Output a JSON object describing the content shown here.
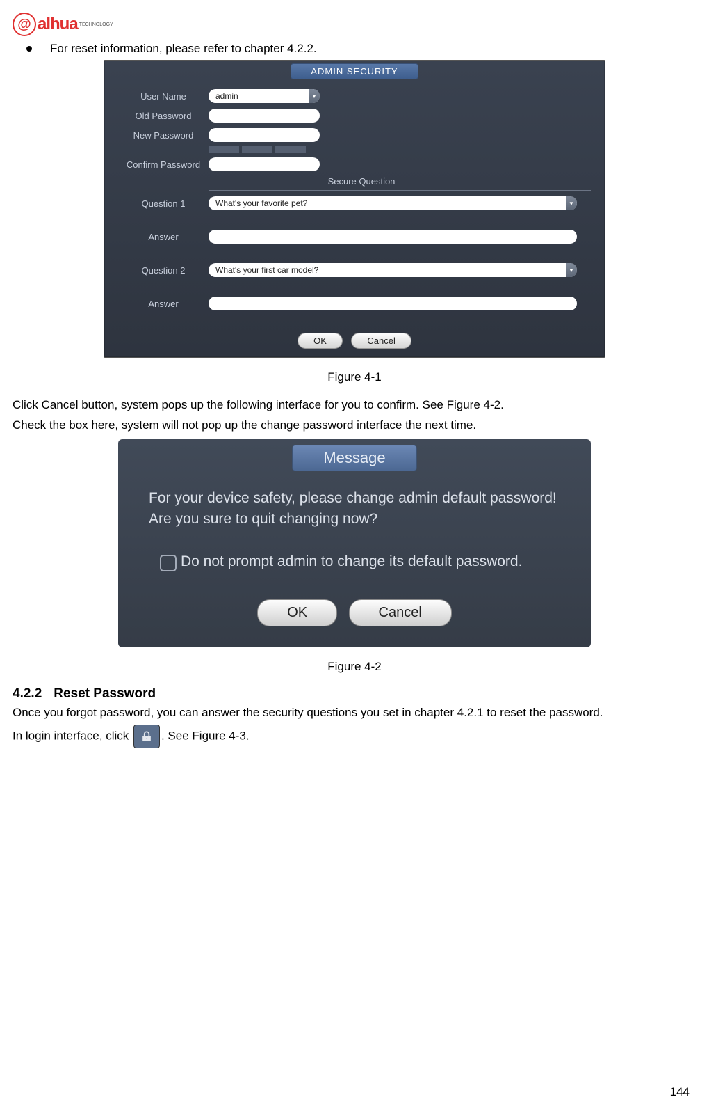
{
  "logo": {
    "brand": "alhua",
    "sub": "TECHNOLOGY"
  },
  "bullet_text": "For reset information, please refer to chapter 4.2.2.",
  "fig1": {
    "title": "ADMIN SECURITY",
    "labels": {
      "username": "User Name",
      "old_pw": "Old Password",
      "new_pw": "New Password",
      "confirm_pw": "Confirm Password",
      "secure_q": "Secure Question",
      "q1": "Question 1",
      "answer": "Answer",
      "q2": "Question 2"
    },
    "values": {
      "username": "admin",
      "q1": "What's your favorite pet?",
      "q2": "What's your first car model?"
    },
    "buttons": {
      "ok": "OK",
      "cancel": "Cancel"
    },
    "caption": "Figure 4-1"
  },
  "para1": "Click Cancel button, system pops up the following interface for you to confirm. See Figure 4-2.",
  "para2": "Check the box here, system will not pop up the change password interface the next time.",
  "fig2": {
    "title": "Message",
    "body": "For your device safety, please change admin default password! Are you sure to quit changing now?",
    "checkbox_label": "Do not prompt admin to change its default password.",
    "buttons": {
      "ok": "OK",
      "cancel": "Cancel"
    },
    "caption": "Figure 4-2"
  },
  "heading": {
    "num": "4.2.2",
    "title": "Reset Password"
  },
  "para3": "Once you forgot password, you can answer the security questions you set in chapter 4.2.1 to reset the password.",
  "para4a": "In login interface, click",
  "para4b": ". See Figure 4-3.",
  "page_num": "144"
}
